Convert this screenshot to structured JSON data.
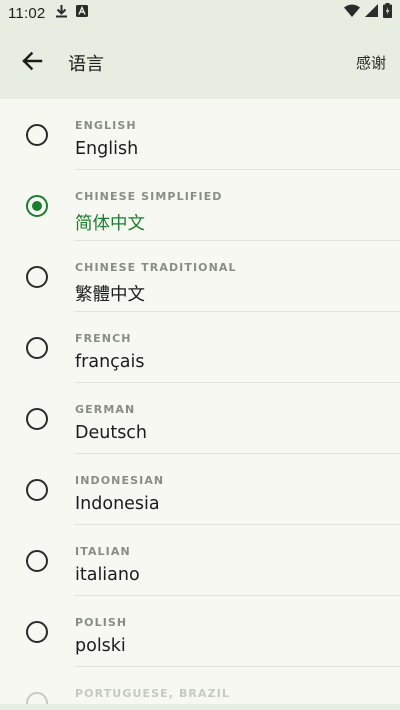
{
  "status_bar": {
    "time": "11:02",
    "icons": [
      "download-icon",
      "app-notification-icon",
      "wifi-icon",
      "signal-icon",
      "battery-icon"
    ]
  },
  "app_bar": {
    "title": "语言",
    "action_label": "感谢",
    "back_icon": "arrow-left-icon"
  },
  "colors": {
    "accent": "#1b7d2e",
    "bar_background": "#e7ede1",
    "page_background": "#f6f8f1"
  },
  "languages": [
    {
      "code": "ENGLISH",
      "name": "English",
      "selected": false
    },
    {
      "code": "CHINESE SIMPLIFIED",
      "name": "简体中文",
      "selected": true
    },
    {
      "code": "CHINESE TRADITIONAL",
      "name": "繁體中文",
      "selected": false
    },
    {
      "code": "FRENCH",
      "name": "français",
      "selected": false
    },
    {
      "code": "GERMAN",
      "name": "Deutsch",
      "selected": false
    },
    {
      "code": "INDONESIAN",
      "name": "Indonesia",
      "selected": false
    },
    {
      "code": "ITALIAN",
      "name": "italiano",
      "selected": false
    },
    {
      "code": "POLISH",
      "name": "polski",
      "selected": false
    },
    {
      "code": "PORTUGUESE, BRAZIL",
      "name": "",
      "selected": false
    }
  ]
}
